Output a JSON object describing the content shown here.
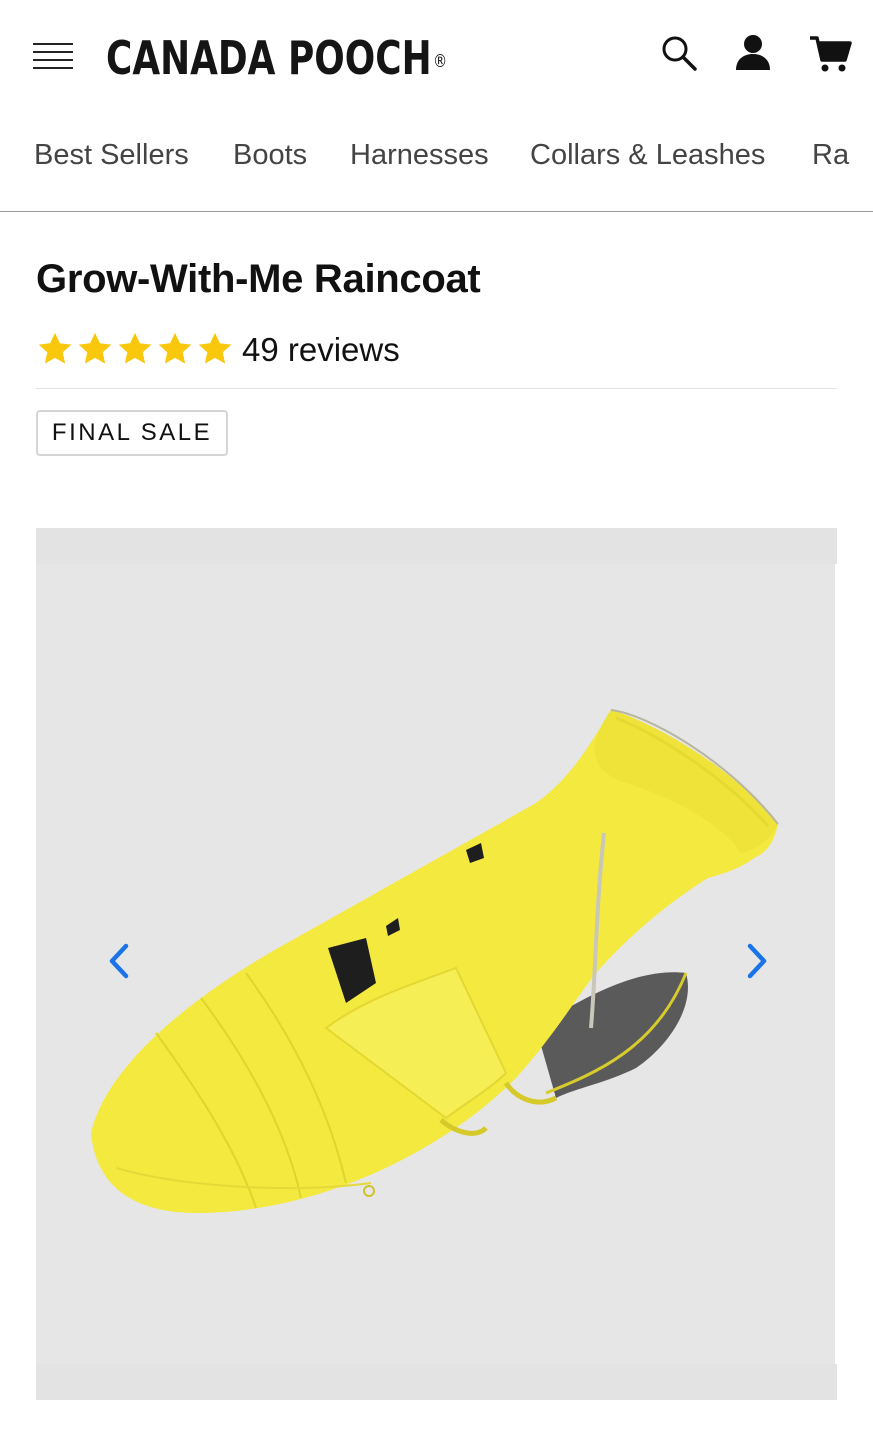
{
  "brand": {
    "name": "CANADA POOCH",
    "registered": "®"
  },
  "header": {
    "menu_icon": "hamburger-menu-icon",
    "search_icon": "search-icon",
    "account_icon": "account-icon",
    "cart_icon": "cart-icon"
  },
  "categories": [
    {
      "label": "Best Sellers"
    },
    {
      "label": "Boots"
    },
    {
      "label": "Harnesses"
    },
    {
      "label": "Collars & Leashes"
    },
    {
      "label": "Ra"
    }
  ],
  "product": {
    "title": "Grow-With-Me Raincoat",
    "rating": 5,
    "rating_max": 5,
    "reviews_label": "49 reviews",
    "badge": "FINAL SALE"
  },
  "gallery": {
    "prev_icon": "chevron-left-icon",
    "next_icon": "chevron-right-icon",
    "image_subject": "yellow dog raincoat"
  },
  "colors": {
    "star": "#f9c70c",
    "arrow": "#1a73e8",
    "gallery_bg": "#e6e6e6",
    "coat_yellow": "#f4e93f"
  }
}
